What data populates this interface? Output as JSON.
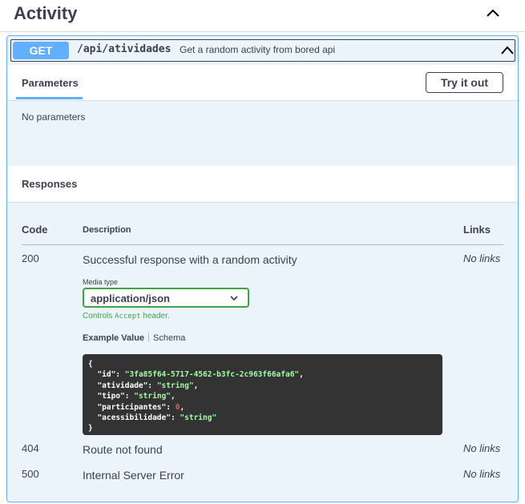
{
  "tag": {
    "title": "Activity"
  },
  "operation": {
    "method": "GET",
    "path": "/api/atividades",
    "description": "Get a random activity from bored api"
  },
  "parameters": {
    "tab_label": "Parameters",
    "try_out_label": "Try it out",
    "empty_text": "No parameters"
  },
  "responses": {
    "title": "Responses",
    "columns": {
      "code": "Code",
      "description": "Description",
      "links": "Links"
    },
    "rows": [
      {
        "code": "200",
        "description": "Successful response with a random activity",
        "links": "No links"
      },
      {
        "code": "404",
        "description": "Route not found",
        "links": "No links"
      },
      {
        "code": "500",
        "description": "Internal Server Error",
        "links": "No links"
      }
    ],
    "media": {
      "label": "Media type",
      "selected": "application/json",
      "controls_prefix": "Controls ",
      "controls_code": "Accept",
      "controls_suffix": " header."
    },
    "example_tabs": {
      "active": "Example Value",
      "other": "Schema"
    },
    "example": {
      "open": "{",
      "close": "}",
      "fields": [
        {
          "key": "\"id\"",
          "value": "\"3fa85f64-5717-4562-b3fc-2c963f66afa6\"",
          "kind": "str"
        },
        {
          "key": "\"atividade\"",
          "value": "\"string\"",
          "kind": "str"
        },
        {
          "key": "\"tipo\"",
          "value": "\"string\"",
          "kind": "str"
        },
        {
          "key": "\"participantes\"",
          "value": "0",
          "kind": "num"
        },
        {
          "key": "\"acessibilidade\"",
          "value": "\"string\"",
          "kind": "str"
        }
      ]
    }
  },
  "colors": {
    "get_accent": "#61affe",
    "success_green": "#41a14b",
    "text": "#3b4151",
    "code_bg": "#333333"
  }
}
